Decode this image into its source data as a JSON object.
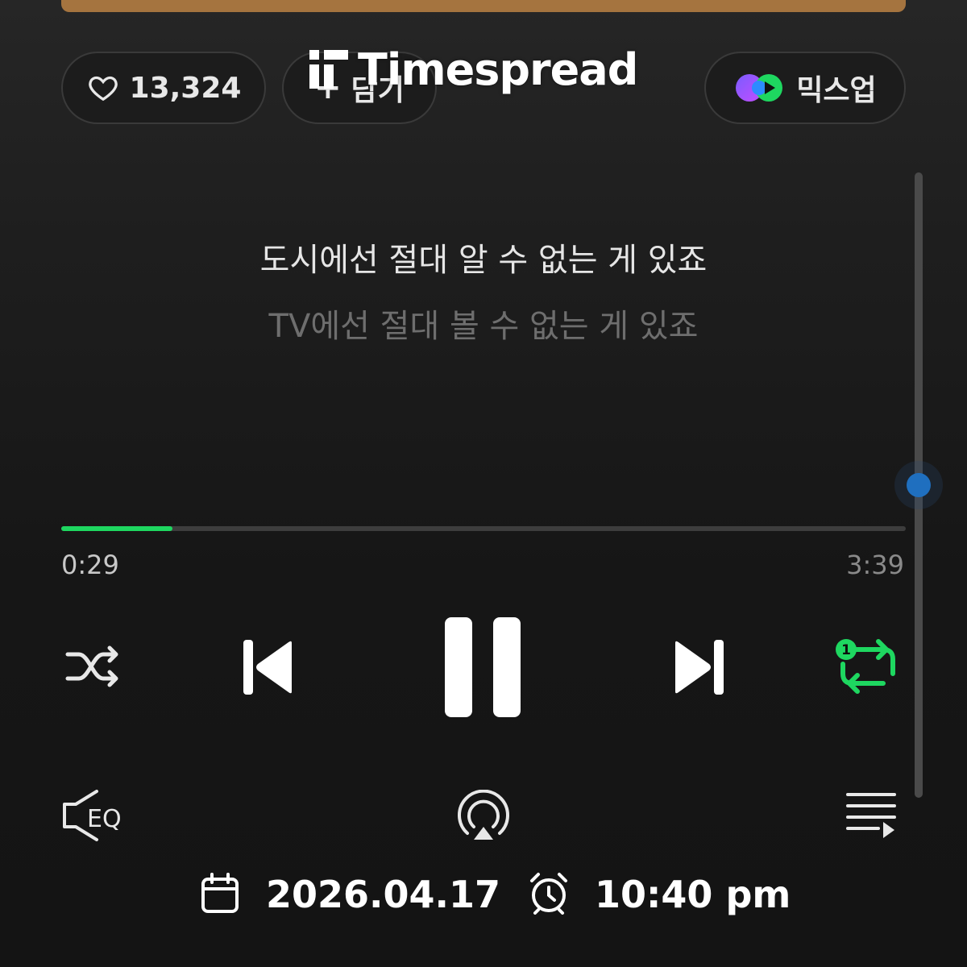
{
  "actions": {
    "like_count": "13,324",
    "add_label": "담기",
    "mixup_label": "믹스업"
  },
  "brand": {
    "name": "Timespread"
  },
  "lyrics": {
    "current": "도시에선 절대 알 수 없는 게 있죠",
    "next": "TV에선 절대 볼 수 없는 게 있죠"
  },
  "player": {
    "elapsed": "0:29",
    "duration": "3:39",
    "progress": 0.132,
    "repeat_mode_badge": "1"
  },
  "footer": {
    "date": "2026.04.17",
    "time": "10:40 pm"
  },
  "colors": {
    "accent": "#1ed760",
    "scroll_thumb": "#1f6fbf"
  },
  "icons": [
    "heart-icon",
    "plus-icon",
    "mixup-icon",
    "shuffle-icon",
    "previous-icon",
    "pause-icon",
    "next-icon",
    "repeat-one-icon",
    "eq-icon",
    "airplay-icon",
    "playlist-icon",
    "calendar-icon",
    "alarm-clock-icon"
  ]
}
